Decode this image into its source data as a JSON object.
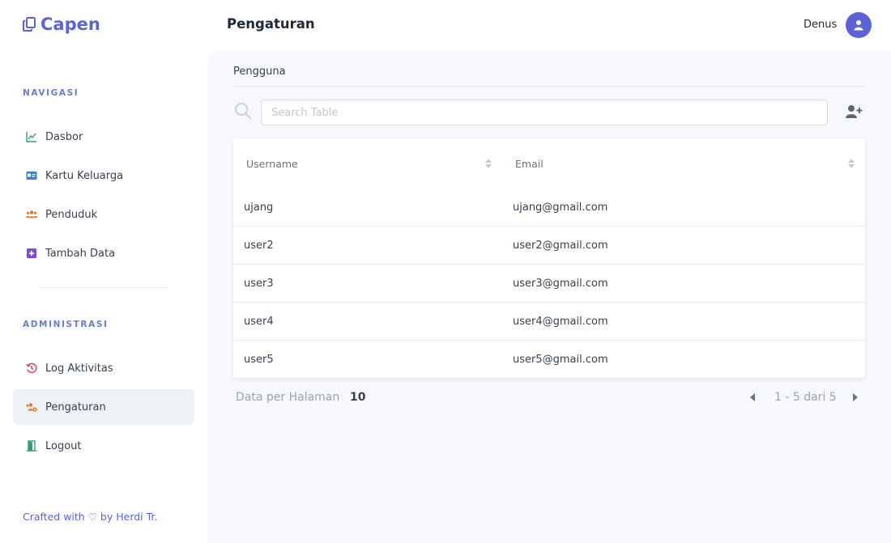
{
  "app": {
    "brand": "Capen"
  },
  "header": {
    "title": "Pengaturan",
    "user_name": "Denus"
  },
  "sidebar": {
    "section_nav": "NAVIGASI",
    "section_admin": "ADMINISTRASI",
    "nav_items": [
      {
        "label": "Dasbor",
        "icon": "chart-line-icon",
        "color": "#2f9e7a"
      },
      {
        "label": "Kartu Keluarga",
        "icon": "id-card-icon",
        "color": "#3b82c4"
      },
      {
        "label": "Penduduk",
        "icon": "users-icon",
        "color": "#e07b2a"
      },
      {
        "label": "Tambah Data",
        "icon": "plus-square-icon",
        "color": "#7c4ddb"
      }
    ],
    "admin_items": [
      {
        "label": "Log Aktivitas",
        "icon": "history-icon",
        "color": "#d6456e"
      },
      {
        "label": "Pengaturan",
        "icon": "users-cog-icon",
        "color": "#e07b2a",
        "active": true
      },
      {
        "label": "Logout",
        "icon": "door-open-icon",
        "color": "#2f9e7a"
      }
    ],
    "footer": {
      "prefix": "Crafted with",
      "heart": "♡",
      "suffix": "by Herdi Tr."
    }
  },
  "main": {
    "card_title": "Pengguna",
    "search": {
      "placeholder": "Search Table",
      "value": ""
    },
    "table": {
      "columns": [
        "Username",
        "Email"
      ],
      "rows": [
        {
          "username": "ujang",
          "email": "ujang@gmail.com"
        },
        {
          "username": "user2",
          "email": "user2@gmail.com"
        },
        {
          "username": "user3",
          "email": "user3@gmail.com"
        },
        {
          "username": "user4",
          "email": "user4@gmail.com"
        },
        {
          "username": "user5",
          "email": "user5@gmail.com"
        }
      ]
    },
    "pagination": {
      "per_page_label": "Data per Halaman",
      "per_page_value": "10",
      "range_text": "1 - 5 dari 5"
    }
  },
  "colors": {
    "brand": "#5865d8",
    "avatar": "#5b63d6",
    "active_bg": "#eef1f6",
    "main_bg": "#f7f8fb"
  }
}
